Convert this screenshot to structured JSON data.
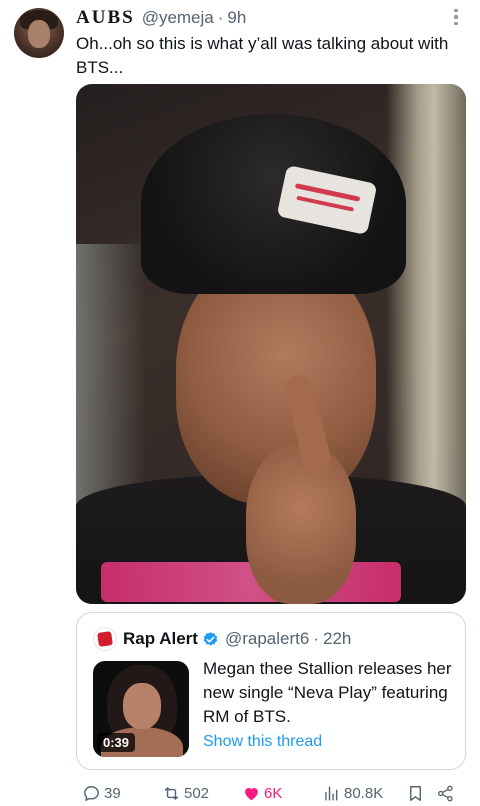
{
  "tweet": {
    "author_name": "AUBS",
    "handle": "@yemeja",
    "separator": "·",
    "time": "9h",
    "text": "Oh...oh so this is what y’all was talking about with BTS..."
  },
  "quoted_tweet": {
    "author_name": "Rap Alert",
    "handle": "@rapalert6",
    "separator": "·",
    "time": "22h",
    "text": "Megan thee Stallion releases her new single “Neva Play” featuring RM of BTS.",
    "video_duration": "0:39",
    "show_thread_label": "Show this thread"
  },
  "actions": {
    "replies": "39",
    "retweets": "502",
    "likes": "6K",
    "views": "80.8K"
  },
  "colors": {
    "link": "#1d9bf0",
    "like": "#f91880",
    "muted": "#536471",
    "verified": "#1d9bf0"
  },
  "icons": [
    "more-icon",
    "verified-badge-icon",
    "reply-icon",
    "retweet-icon",
    "heart-icon",
    "views-icon",
    "bookmark-icon",
    "share-icon"
  ]
}
